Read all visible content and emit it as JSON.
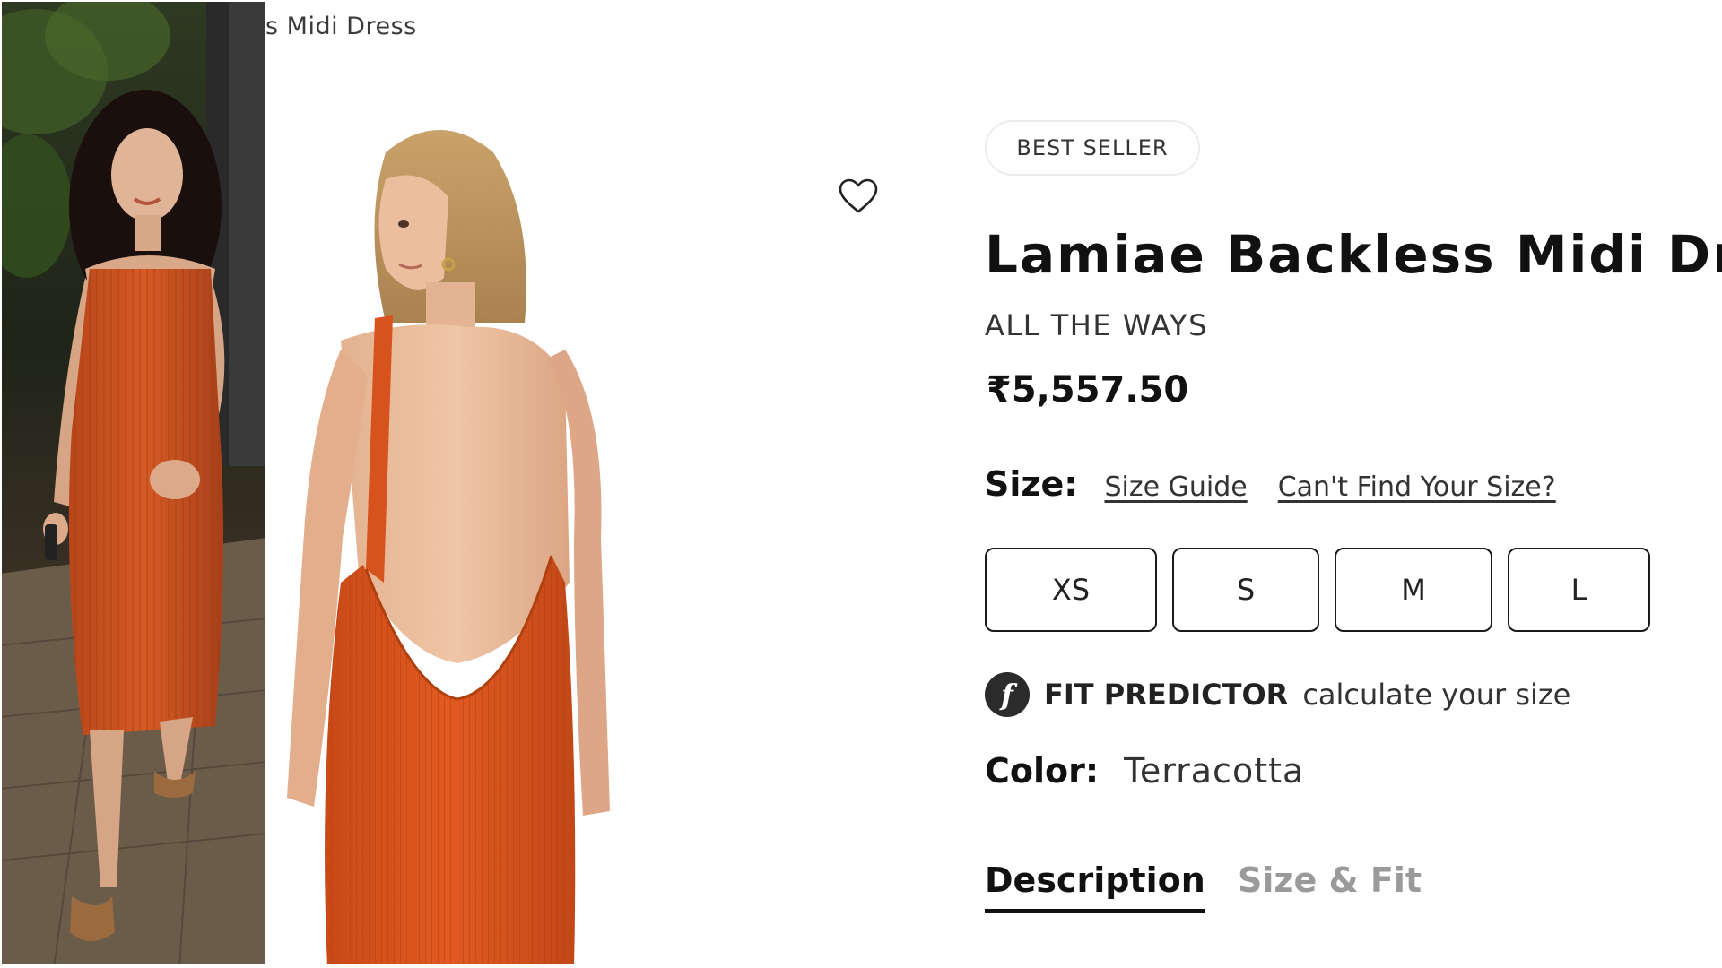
{
  "breadcrumb": {
    "text": "s Midi Dress"
  },
  "product": {
    "badge": "BEST SELLER",
    "title": "Lamiae Backless Midi Dre",
    "brand": "ALL THE WAYS",
    "price": "₹5,557.50"
  },
  "size": {
    "label": "Size:",
    "guide_link": "Size Guide",
    "cant_find_link": "Can't Find Your Size?",
    "options": [
      "XS",
      "S",
      "M",
      "L"
    ]
  },
  "fit_predictor": {
    "logo_letter": "f",
    "title": "FIT PREDICTOR",
    "subtitle": "calculate your size"
  },
  "color": {
    "label": "Color:",
    "value": "Terracotta",
    "swatch": "#d9531e"
  },
  "tabs": {
    "description": "Description",
    "size_fit": "Size & Fit",
    "active": "Description"
  },
  "icons": {
    "wishlist": "heart-outline-icon"
  }
}
